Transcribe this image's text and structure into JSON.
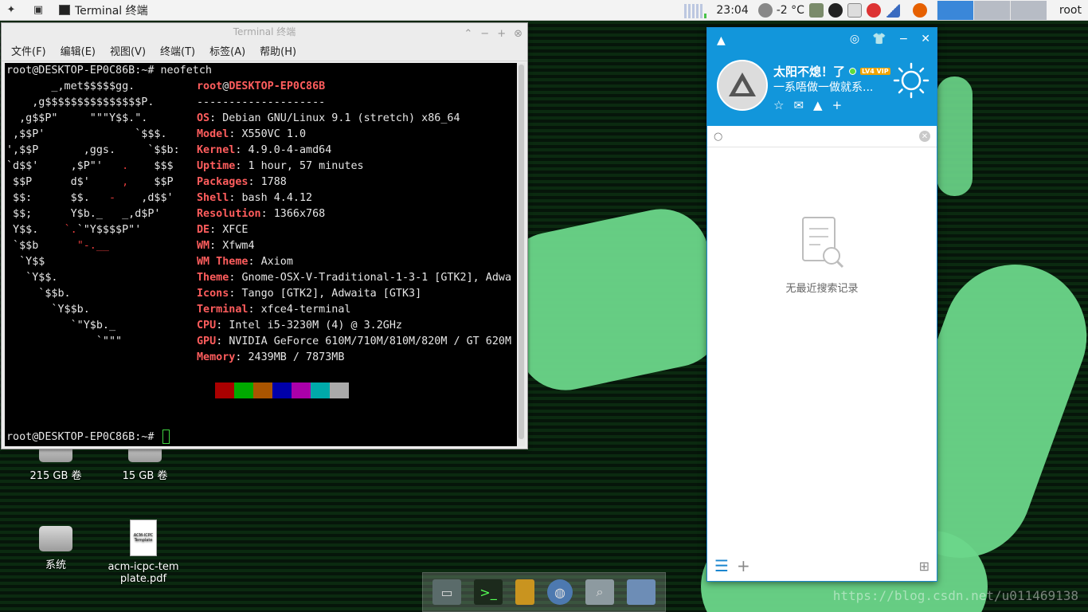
{
  "topbar": {
    "app_menu_icon": "xfce-mouse-icon",
    "show_desktop_icon": "show-desktop-icon",
    "task_title": "Terminal 终端",
    "clock": "23:04",
    "weather": "-2 °C",
    "user": "root"
  },
  "terminal": {
    "title": "Terminal 终端",
    "menu": [
      "文件(F)",
      "编辑(E)",
      "视图(V)",
      "终端(T)",
      "标签(A)",
      "帮助(H)"
    ],
    "command_line": "root@DESKTOP-EP0C86B:~# neofetch",
    "prompt": "root@DESKTOP-EP0C86B:~#",
    "header_user": "root",
    "header_at": "@",
    "header_host": "DESKTOP-EP0C86B",
    "separator": "--------------------",
    "info": [
      {
        "key": "OS",
        "value": "Debian GNU/Linux 9.1 (stretch) x86_64"
      },
      {
        "key": "Model",
        "value": "X550VC 1.0"
      },
      {
        "key": "Kernel",
        "value": "4.9.0-4-amd64"
      },
      {
        "key": "Uptime",
        "value": "1 hour, 57 minutes"
      },
      {
        "key": "Packages",
        "value": "1788"
      },
      {
        "key": "Shell",
        "value": "bash 4.4.12"
      },
      {
        "key": "Resolution",
        "value": "1366x768"
      },
      {
        "key": "DE",
        "value": "XFCE"
      },
      {
        "key": "WM",
        "value": "Xfwm4"
      },
      {
        "key": "WM Theme",
        "value": "Axiom"
      },
      {
        "key": "Theme",
        "value": "Gnome-OSX-V-Traditional-1-3-1 [GTK2], Adwa"
      },
      {
        "key": "Icons",
        "value": "Tango [GTK2], Adwaita [GTK3]"
      },
      {
        "key": "Terminal",
        "value": "xfce4-terminal"
      },
      {
        "key": "CPU",
        "value": "Intel i5-3230M (4) @ 3.2GHz"
      },
      {
        "key": "GPU",
        "value": "NVIDIA GeForce 610M/710M/810M/820M / GT 620M"
      },
      {
        "key": "Memory",
        "value": "2439MB / 7873MB"
      }
    ],
    "color_swatches": [
      "#aa0000",
      "#00aa00",
      "#aa5500",
      "#0000aa",
      "#aa00aa",
      "#00aaaa",
      "#aaaaaa"
    ]
  },
  "qq": {
    "nickname": "太阳不熄！了",
    "vip_badge": "LV4 VIP",
    "signature": "一系唔做一做就系...",
    "search_value": "",
    "empty_text": "无最近搜索记录"
  },
  "desktop": {
    "icons": [
      {
        "label": "215 GB 卷"
      },
      {
        "label": "15 GB 卷"
      },
      {
        "label": "系统"
      },
      {
        "label": "acm-icpc-template.pdf"
      }
    ],
    "pdf_thumb_text": "ACM-ICPC Template"
  },
  "watermark": "https://blog.csdn.net/u011469138"
}
